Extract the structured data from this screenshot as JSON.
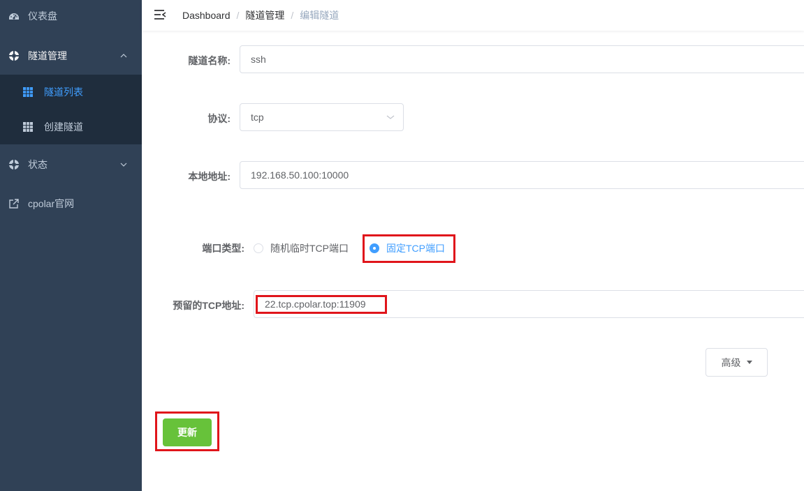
{
  "sidebar": {
    "dashboard_label": "仪表盘",
    "tunnel_mgmt_label": "隧道管理",
    "tunnel_list_label": "隧道列表",
    "create_tunnel_label": "创建隧道",
    "status_label": "状态",
    "official_site_label": "cpolar官网"
  },
  "breadcrumb": {
    "items": [
      "Dashboard",
      "隧道管理",
      "编辑隧道"
    ],
    "separator": "/"
  },
  "form": {
    "name_label": "隧道名称:",
    "name_value": "ssh",
    "protocol_label": "协议:",
    "protocol_value": "tcp",
    "local_addr_label": "本地地址:",
    "local_addr_value": "192.168.50.100:10000",
    "port_type_label": "端口类型:",
    "port_type_options": [
      "随机临时TCP端口",
      "固定TCP端口"
    ],
    "port_type_selected": "固定TCP端口",
    "reserved_label": "预留的TCP地址:",
    "reserved_value": "22.tcp.cpolar.top:11909",
    "advanced_label": "高级",
    "update_label": "更新"
  },
  "colors": {
    "sidebar_bg": "#304156",
    "submenu_bg": "#1f2d3d",
    "active": "#409eff",
    "success": "#67c23a",
    "highlight": "#e0151b"
  }
}
